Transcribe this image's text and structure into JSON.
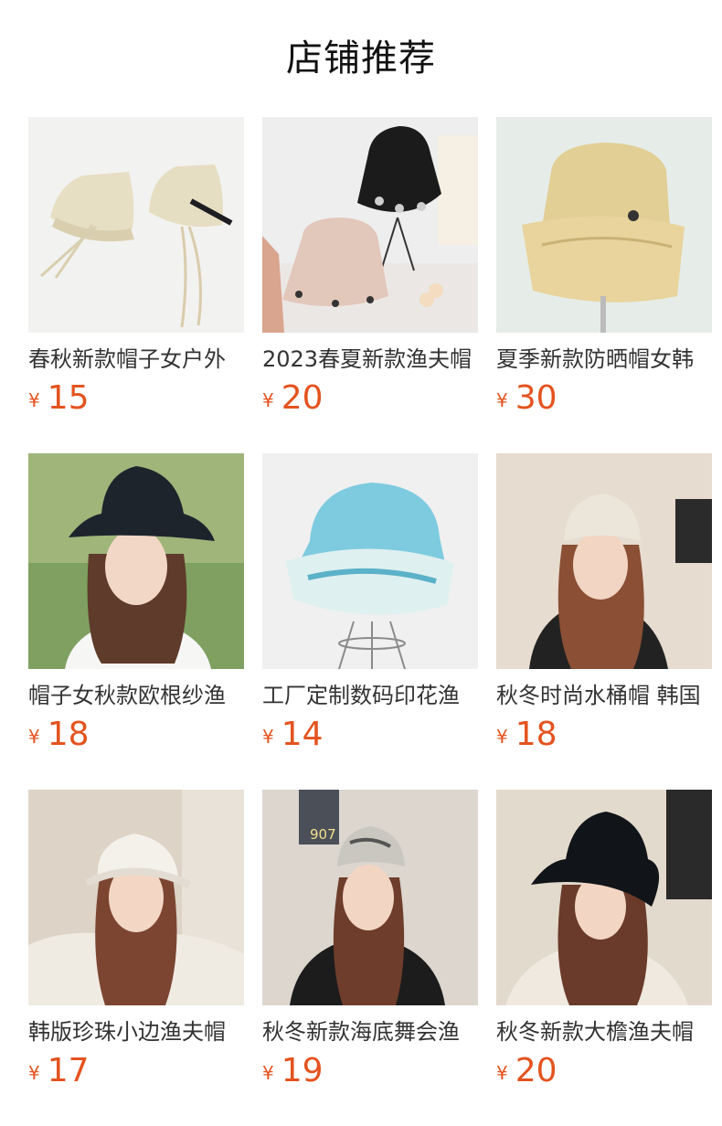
{
  "header": {
    "title": "店铺推荐"
  },
  "currency_symbol": "¥",
  "products": [
    {
      "name": "春秋新款帽子女户外",
      "price": "15",
      "icon": "beige-bucket-hat-photo"
    },
    {
      "name": "2023春夏新款渔夫帽",
      "price": "20",
      "icon": "black-and-pink-bucket-hats-photo"
    },
    {
      "name": "夏季新款防晒帽女韩",
      "price": "30",
      "icon": "straw-sun-hat-photo"
    },
    {
      "name": "帽子女秋款欧根纱渔",
      "price": "18",
      "icon": "model-black-organza-hat-photo"
    },
    {
      "name": "工厂定制数码印花渔",
      "price": "14",
      "icon": "blue-printed-bucket-hat-photo"
    },
    {
      "name": "秋冬时尚水桶帽 韩国",
      "price": "18",
      "icon": "model-cream-bucket-hat-photo"
    },
    {
      "name": "韩版珍珠小边渔夫帽",
      "price": "17",
      "icon": "model-white-pearl-hat-photo"
    },
    {
      "name": "秋冬新款海底舞会渔",
      "price": "19",
      "icon": "model-printed-bucket-hat-photo"
    },
    {
      "name": "秋冬新款大檐渔夫帽",
      "price": "20",
      "icon": "model-black-fringe-hat-photo"
    }
  ],
  "photo_text": {
    "sign_number": "907"
  },
  "colors": {
    "price": "#e4531f",
    "title": "#111111",
    "text": "#333333"
  }
}
